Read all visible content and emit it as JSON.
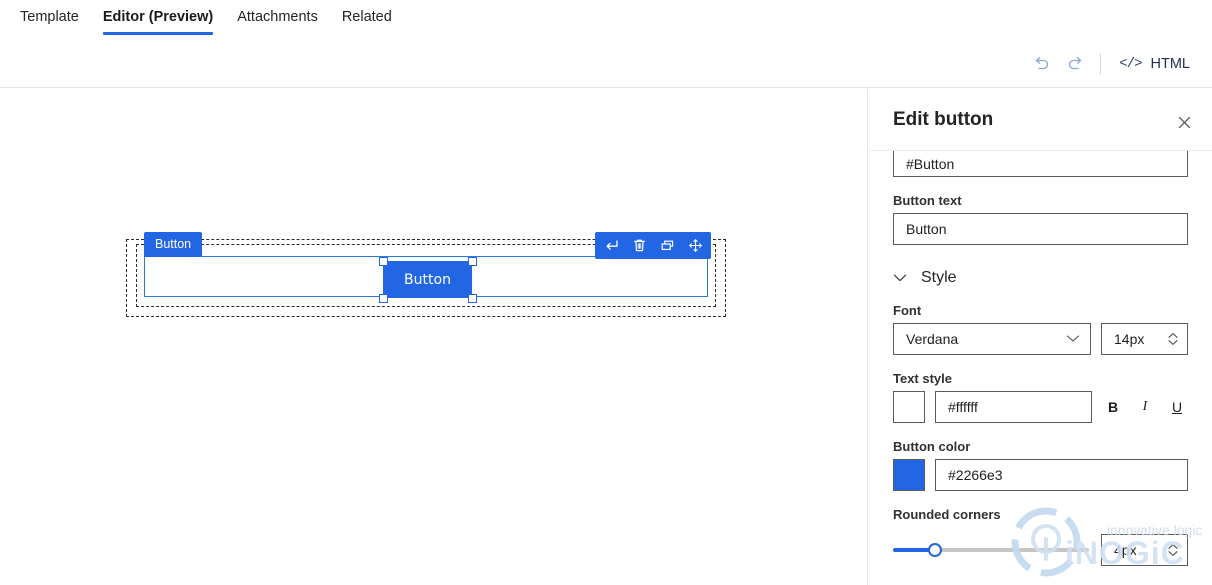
{
  "tabs": [
    {
      "label": "Template",
      "active": false
    },
    {
      "label": "Editor (Preview)",
      "active": true
    },
    {
      "label": "Attachments",
      "active": false
    },
    {
      "label": "Related",
      "active": false
    }
  ],
  "commandbar": {
    "undo_icon": "undo-arrow-icon",
    "redo_icon": "redo-arrow-icon",
    "code_icon": "</>",
    "html_label": "HTML"
  },
  "canvas": {
    "element_tag": "Button",
    "selected_button_text": "Button",
    "toolbar_icons": [
      {
        "name": "return-icon",
        "glyph": "↵"
      },
      {
        "name": "delete-icon",
        "glyph": "🗑"
      },
      {
        "name": "duplicate-icon",
        "glyph": "❐"
      },
      {
        "name": "move-icon",
        "glyph": "✥"
      }
    ]
  },
  "panel": {
    "title": "Edit button",
    "close_icon": "✕",
    "link_value": "#Button",
    "button_text_label": "Button text",
    "button_text_value": "Button",
    "style_section": {
      "title": "Style",
      "chevron": "⌄",
      "font_label": "Font",
      "font_value": "Verdana",
      "font_size_value": "14px",
      "text_style_label": "Text style",
      "text_color_value": "#ffffff",
      "text_color_swatch": "#ffffff",
      "bold_label": "B",
      "italic_label": "I",
      "underline_label": "U",
      "button_color_label": "Button color",
      "button_color_value": "#2266e3",
      "button_color_swatch": "#2266e3",
      "rounded_corners_label": "Rounded corners",
      "rounded_corners_value": "4px"
    }
  },
  "watermark": {
    "tagline": "innovative logic",
    "brand": "iNOGiC"
  },
  "colors": {
    "accent": "#2266e3",
    "tab_underline": "#2266e3",
    "panel_border": "#5b5b5b"
  }
}
